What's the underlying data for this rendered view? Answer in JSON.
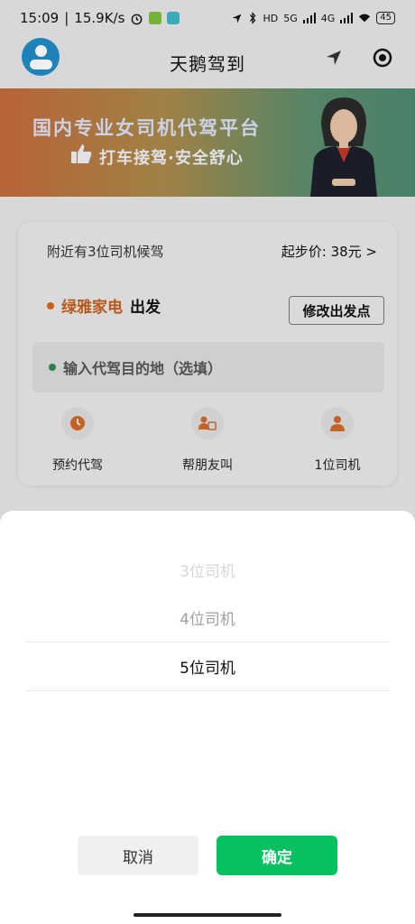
{
  "status_bar": {
    "time": "15:09",
    "speed": "15.9K/s",
    "network_5g": "5G",
    "network_4g": "4G",
    "hd": "HD",
    "battery": "45"
  },
  "header": {
    "title": "天鹅驾到"
  },
  "banner": {
    "title": "国内专业女司机代驾平台",
    "subtitle": "打车接驾·安全舒心"
  },
  "card": {
    "nearby_text": "附近有3位司机候驾",
    "start_price": "起步价: 38元 >",
    "start_place": "绿雅家电",
    "start_suffix": "出发",
    "modify_button": "修改出发点",
    "destination_placeholder": "输入代驾目的地（选填）",
    "features": [
      {
        "label": "预约代驾",
        "icon": "clock-icon"
      },
      {
        "label": "帮朋友叫",
        "icon": "friend-call-icon"
      },
      {
        "label": "1位司机",
        "icon": "driver-icon"
      }
    ]
  },
  "picker": {
    "options": [
      "3位司机",
      "4位司机",
      "5位司机"
    ],
    "selected": "5位司机"
  },
  "buttons": {
    "cancel": "取消",
    "confirm": "确定"
  },
  "colors": {
    "accent_green": "#07c160",
    "start_orange": "#c45f1e",
    "avatar_blue": "#1f8cc4"
  }
}
